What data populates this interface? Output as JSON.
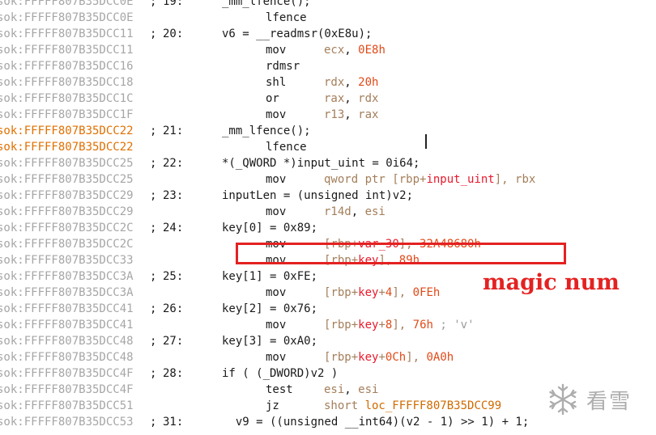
{
  "listing": [
    {
      "addr": "sok:FFFFF807B35DCC0E",
      "hl": false,
      "line": "19:",
      "code": "_mm_lfence();"
    },
    {
      "addr": "sok:FFFFF807B35DCC0E",
      "hl": false,
      "mnem": "lfence",
      "ops": []
    },
    {
      "addr": "sok:FFFFF807B35DCC11",
      "hl": false,
      "line": "20:",
      "code": "v6 = __readmsr(0xE8u);"
    },
    {
      "addr": "sok:FFFFF807B35DCC11",
      "hl": false,
      "mnem": "mov",
      "ops": [
        {
          "t": "ecx",
          "c": "reg"
        },
        {
          "t": ", ",
          "c": "kw"
        },
        {
          "t": "0E8h",
          "c": "num"
        }
      ]
    },
    {
      "addr": "sok:FFFFF807B35DCC16",
      "hl": false,
      "mnem": "rdmsr",
      "ops": []
    },
    {
      "addr": "sok:FFFFF807B35DCC18",
      "hl": false,
      "mnem": "shl",
      "ops": [
        {
          "t": "rdx",
          "c": "reg"
        },
        {
          "t": ", ",
          "c": "kw"
        },
        {
          "t": "20h",
          "c": "num"
        }
      ]
    },
    {
      "addr": "sok:FFFFF807B35DCC1C",
      "hl": false,
      "mnem": "or",
      "ops": [
        {
          "t": "rax",
          "c": "reg"
        },
        {
          "t": ", ",
          "c": "kw"
        },
        {
          "t": "rdx",
          "c": "reg"
        }
      ]
    },
    {
      "addr": "sok:FFFFF807B35DCC1F",
      "hl": false,
      "mnem": "mov",
      "ops": [
        {
          "t": "r13",
          "c": "reg"
        },
        {
          "t": ", ",
          "c": "kw"
        },
        {
          "t": "rax",
          "c": "reg"
        }
      ]
    },
    {
      "addr": "sok:FFFFF807B35DCC22",
      "hl": true,
      "line": "21:",
      "code": "_mm_lfence();"
    },
    {
      "addr": "sok:FFFFF807B35DCC22",
      "hl": true,
      "mnem": "lfence",
      "ops": []
    },
    {
      "addr": "sok:FFFFF807B35DCC25",
      "hl": false,
      "line": "22:",
      "code": "*(_QWORD *)input_uint = 0i64;"
    },
    {
      "addr": "sok:FFFFF807B35DCC25",
      "hl": false,
      "mnem": "mov",
      "ops": [
        {
          "t": "qword ptr [",
          "c": "reg"
        },
        {
          "t": "rbp",
          "c": "reg"
        },
        {
          "t": "+",
          "c": "reg"
        },
        {
          "t": "input_uint",
          "c": "var"
        },
        {
          "t": "], ",
          "c": "reg"
        },
        {
          "t": "rbx",
          "c": "reg"
        }
      ]
    },
    {
      "addr": "sok:FFFFF807B35DCC29",
      "hl": false,
      "line": "23:",
      "code": "inputLen = (unsigned int)v2;"
    },
    {
      "addr": "sok:FFFFF807B35DCC29",
      "hl": false,
      "mnem": "mov",
      "ops": [
        {
          "t": "r14d",
          "c": "reg"
        },
        {
          "t": ", ",
          "c": "kw"
        },
        {
          "t": "esi",
          "c": "reg"
        }
      ]
    },
    {
      "addr": "sok:FFFFF807B35DCC2C",
      "hl": false,
      "line": "24:",
      "code": "key[0] = 0x89;"
    },
    {
      "addr": "sok:FFFFF807B35DCC2C",
      "hl": false,
      "mnem": "mov",
      "ops": [
        {
          "t": "[",
          "c": "reg"
        },
        {
          "t": "rbp",
          "c": "reg"
        },
        {
          "t": "+",
          "c": "reg"
        },
        {
          "t": "var_30",
          "c": "var"
        },
        {
          "t": "], ",
          "c": "reg"
        },
        {
          "t": "32A48680h",
          "c": "num"
        }
      ]
    },
    {
      "addr": "sok:FFFFF807B35DCC33",
      "hl": false,
      "mnem": "mov",
      "ops": [
        {
          "t": "[",
          "c": "reg"
        },
        {
          "t": "rbp",
          "c": "reg"
        },
        {
          "t": "+",
          "c": "reg"
        },
        {
          "t": "key",
          "c": "var"
        },
        {
          "t": "], ",
          "c": "reg"
        },
        {
          "t": "89h",
          "c": "num"
        }
      ]
    },
    {
      "addr": "sok:FFFFF807B35DCC3A",
      "hl": false,
      "line": "25:",
      "code": "key[1] = 0xFE;"
    },
    {
      "addr": "sok:FFFFF807B35DCC3A",
      "hl": false,
      "mnem": "mov",
      "ops": [
        {
          "t": "[",
          "c": "reg"
        },
        {
          "t": "rbp",
          "c": "reg"
        },
        {
          "t": "+",
          "c": "reg"
        },
        {
          "t": "key",
          "c": "var"
        },
        {
          "t": "+",
          "c": "reg"
        },
        {
          "t": "4",
          "c": "num"
        },
        {
          "t": "], ",
          "c": "reg"
        },
        {
          "t": "0FEh",
          "c": "num"
        }
      ]
    },
    {
      "addr": "sok:FFFFF807B35DCC41",
      "hl": false,
      "line": "26:",
      "code": "key[2] = 0x76;"
    },
    {
      "addr": "sok:FFFFF807B35DCC41",
      "hl": false,
      "mnem": "mov",
      "ops": [
        {
          "t": "[",
          "c": "reg"
        },
        {
          "t": "rbp",
          "c": "reg"
        },
        {
          "t": "+",
          "c": "reg"
        },
        {
          "t": "key",
          "c": "var"
        },
        {
          "t": "+",
          "c": "reg"
        },
        {
          "t": "8",
          "c": "num"
        },
        {
          "t": "], ",
          "c": "reg"
        },
        {
          "t": "76h",
          "c": "num"
        },
        {
          "t": " ; 'v'",
          "c": "cmt"
        }
      ]
    },
    {
      "addr": "sok:FFFFF807B35DCC48",
      "hl": false,
      "line": "27:",
      "code": "key[3] = 0xA0;"
    },
    {
      "addr": "sok:FFFFF807B35DCC48",
      "hl": false,
      "mnem": "mov",
      "ops": [
        {
          "t": "[",
          "c": "reg"
        },
        {
          "t": "rbp",
          "c": "reg"
        },
        {
          "t": "+",
          "c": "reg"
        },
        {
          "t": "key",
          "c": "var"
        },
        {
          "t": "+",
          "c": "reg"
        },
        {
          "t": "0Ch",
          "c": "num"
        },
        {
          "t": "], ",
          "c": "reg"
        },
        {
          "t": "0A0h",
          "c": "num"
        }
      ]
    },
    {
      "addr": "sok:FFFFF807B35DCC4F",
      "hl": false,
      "line": "28:",
      "code": "if ( (_DWORD)v2 )"
    },
    {
      "addr": "sok:FFFFF807B35DCC4F",
      "hl": false,
      "mnem": "test",
      "ops": [
        {
          "t": "esi",
          "c": "reg"
        },
        {
          "t": ", ",
          "c": "kw"
        },
        {
          "t": "esi",
          "c": "reg"
        }
      ]
    },
    {
      "addr": "sok:FFFFF807B35DCC51",
      "hl": false,
      "mnem": "jz",
      "ops": [
        {
          "t": "short ",
          "c": "reg"
        },
        {
          "t": "loc_FFFFF807B35DCC99",
          "c": "loc"
        }
      ]
    },
    {
      "addr": "sok:FFFFF807B35DCC53",
      "hl": false,
      "line": "31:",
      "code": "  v9 = ((unsigned __int64)(v2 - 1) >> 1) + 1;"
    }
  ],
  "annotation": "magic num",
  "watermark": "看雪",
  "colors": {
    "address": "#a6a6a6",
    "address_highlight": "#e07000",
    "register": "#a47e5a",
    "number": "#e04a18",
    "variable": "#e8192c",
    "annotation": "#e42121"
  },
  "icons": {
    "watermark_logo": "snowflake-icon"
  }
}
